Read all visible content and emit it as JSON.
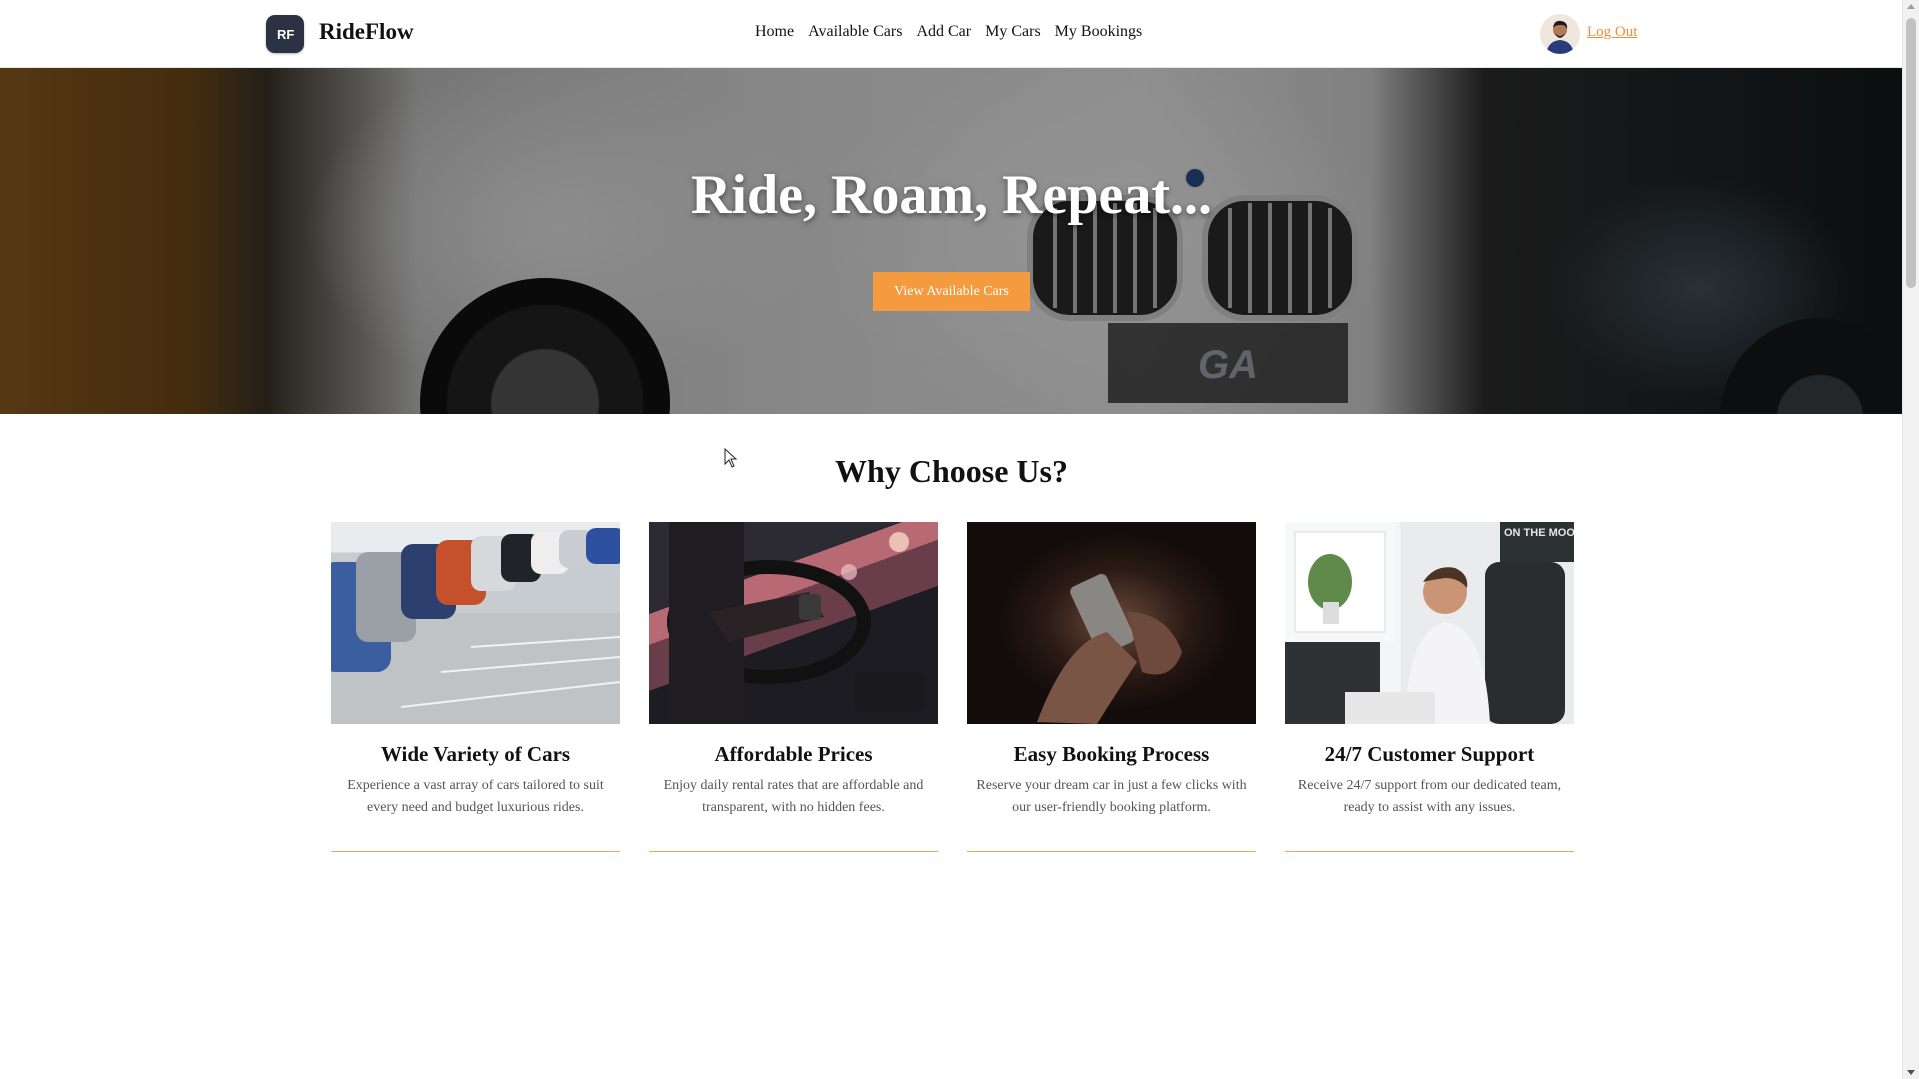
{
  "navbar": {
    "brand": "RideFlow",
    "logo_text": "RF",
    "links": [
      "Home",
      "Available Cars",
      "Add Car",
      "My Cars",
      "My Bookings"
    ],
    "logout": "Log Out"
  },
  "hero": {
    "title": "Ride, Roam, Repeat...",
    "cta": "View Available Cars",
    "plate_text": "GA"
  },
  "why": {
    "title": "Why Choose Us?",
    "cards": [
      {
        "title": "Wide Variety of Cars",
        "text": "Experience a vast array of cars tailored to suit every need and budget luxurious rides.",
        "image": "parking-lot-cars"
      },
      {
        "title": "Affordable Prices",
        "text": "Enjoy daily rental rates that are affordable and transparent, with no hidden fees.",
        "image": "driver-steering-wheel"
      },
      {
        "title": "Easy Booking Process",
        "text": "Reserve your dream car in just a few clicks with our user-friendly booking platform.",
        "image": "hands-holding-phone"
      },
      {
        "title": "24/7 Customer Support",
        "text": "Receive 24/7 support from our dedicated team, ready to assist with any issues.",
        "image": "support-agent-headset",
        "poster_text": "ON THE MOO"
      }
    ]
  },
  "colors": {
    "accent": "#f49a3f",
    "logout": "#f28b35",
    "logo_bg": "#2b3244",
    "card_border": "#f4a35d"
  }
}
